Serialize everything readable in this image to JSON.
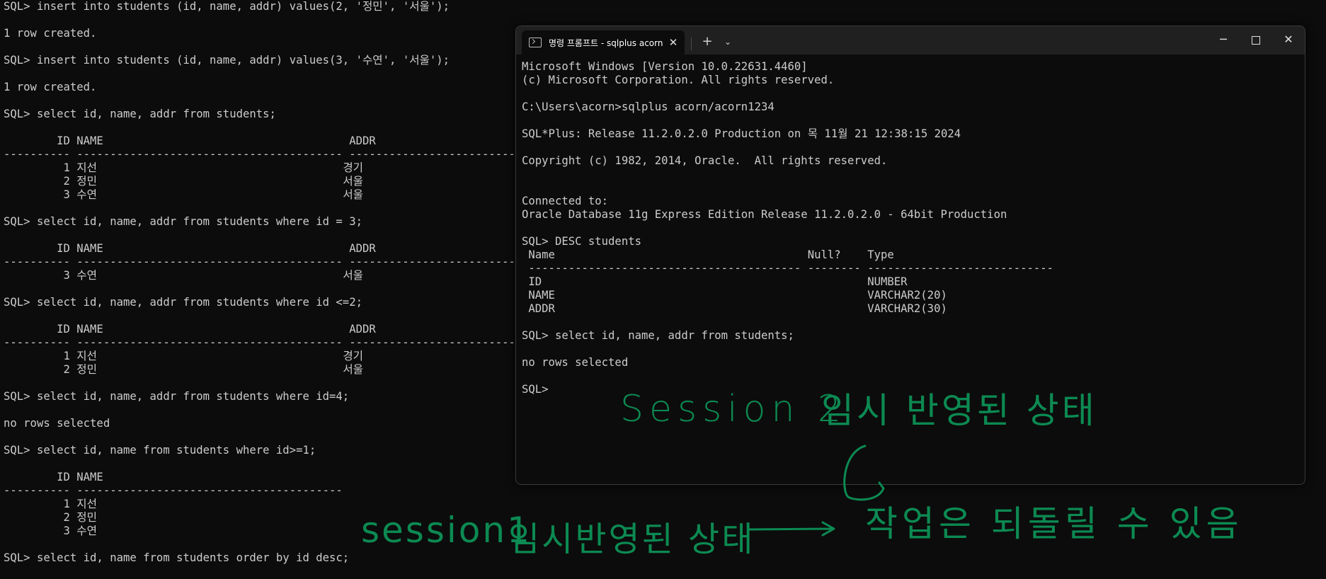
{
  "background_console": {
    "lines": [
      "SQL> insert into students (id, name, addr) values(2, '정민', '서울');",
      "",
      "1 row created.",
      "",
      "SQL> insert into students (id, name, addr) values(3, '수연', '서울');",
      "",
      "1 row created.",
      "",
      "SQL> select id, name, addr from students;",
      "",
      "        ID NAME                                     ADDR",
      "---------- ---------------------------------------- ------------------------------",
      "         1 지선                                     경기",
      "         2 정민                                     서울",
      "         3 수연                                     서울",
      "",
      "SQL> select id, name, addr from students where id = 3;",
      "",
      "        ID NAME                                     ADDR",
      "---------- ---------------------------------------- ------------------------------",
      "         3 수연                                     서울",
      "",
      "SQL> select id, name, addr from students where id <=2;",
      "",
      "        ID NAME                                     ADDR",
      "---------- ---------------------------------------- ------------------------------",
      "         1 지선                                     경기",
      "         2 정민                                     서울",
      "",
      "SQL> select id, name, addr from students where id=4;",
      "",
      "no rows selected",
      "",
      "SQL> select id, name from students where id>=1;",
      "",
      "        ID NAME",
      "---------- ----------------------------------------",
      "         1 지선",
      "         2 정민",
      "         3 수연",
      "",
      "SQL> select id, name from students order by id desc;"
    ]
  },
  "terminal": {
    "tab_title": "명령 프롬프트 - sqlplus  acorn",
    "icons": {
      "tab": "terminal-icon",
      "tab_close": "close-icon",
      "new_tab": "plus-icon",
      "dropdown": "chevron-down-icon",
      "minimize": "minimize-icon",
      "maximize": "maximize-icon",
      "close": "close-icon"
    },
    "lines": [
      "Microsoft Windows [Version 10.0.22631.4460]",
      "(c) Microsoft Corporation. All rights reserved.",
      "",
      "C:\\Users\\acorn>sqlplus acorn/acorn1234",
      "",
      "SQL*Plus: Release 11.2.0.2.0 Production on 목 11월 21 12:38:15 2024",
      "",
      "Copyright (c) 1982, 2014, Oracle.  All rights reserved.",
      "",
      "",
      "Connected to:",
      "Oracle Database 11g Express Edition Release 11.2.0.2.0 - 64bit Production",
      "",
      "SQL> DESC students",
      " Name                                      Null?    Type",
      " ----------------------------------------- -------- ----------------------------",
      " ID                                                 NUMBER",
      " NAME                                               VARCHAR2(20)",
      " ADDR                                               VARCHAR2(30)",
      "",
      "SQL> select id, name, addr from students;",
      "",
      "no rows selected",
      "",
      "SQL>"
    ]
  },
  "annotations": {
    "session2": "Session 2",
    "temp_state_2": "임시 반영된 상태",
    "session1": "session1",
    "temp_state_1": "임시반영된 상태",
    "rollback_note": "작업은 되돌릴 수 있음",
    "color": "#0c8a52"
  },
  "colors": {
    "background": "#0c0c0c",
    "text": "#cccccc",
    "titlebar": "#202020"
  }
}
